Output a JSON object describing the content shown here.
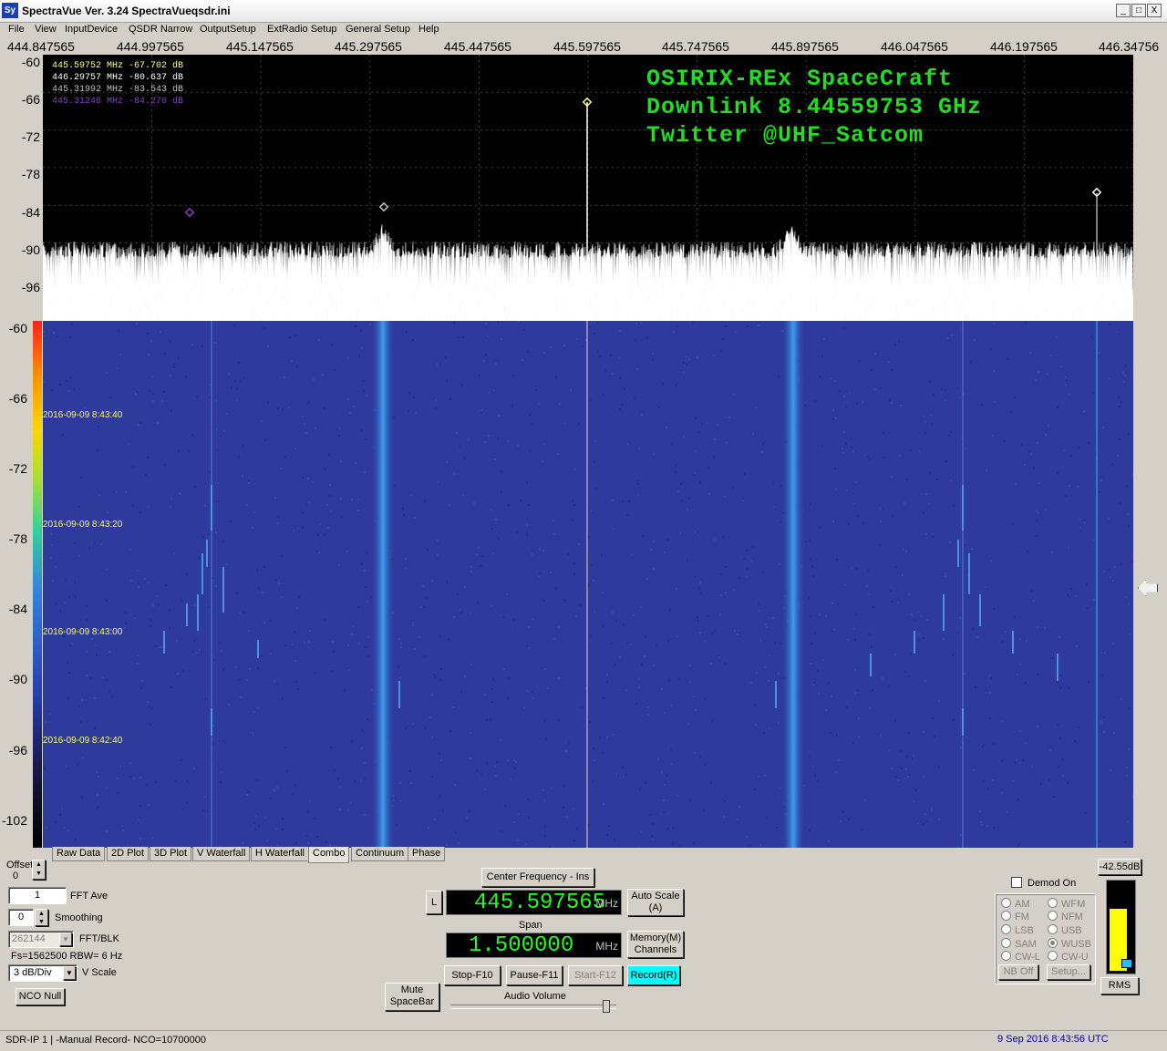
{
  "window": {
    "icon": "Sy",
    "title": "SpectraVue Ver. 3.24  SpectraVueqsdr.ini",
    "min_label": "_",
    "max_label": "□",
    "close_label": "X"
  },
  "menu": [
    "File",
    "View",
    "InputDevice",
    "QSDR Narrow",
    "OutputSetup",
    "ExtRadio Setup",
    "General Setup",
    "Help"
  ],
  "freq_axis": [
    "444.847565",
    "444.997565",
    "445.147565",
    "445.297565",
    "445.447565",
    "445.597565",
    "445.747565",
    "445.897565",
    "446.047565",
    "446.197565",
    "446.34756"
  ],
  "spectrum": {
    "y_labels": [
      "-60",
      "-66",
      "-72",
      "-78",
      "-84",
      "-90",
      "-96"
    ],
    "markers": [
      {
        "text": "445.59752 MHz -67.702 dB",
        "color": "#ffff80"
      },
      {
        "text": "446.29757 MHz -80.637 dB",
        "color": "#ffffff"
      },
      {
        "text": "445.31992 MHz -83.543 dB",
        "color": "#c0c0c0"
      },
      {
        "text": "445.31246 MHz -84.270 dB",
        "color": "#8040c0"
      }
    ],
    "overlay": [
      "OSIRIX-REx SpaceCraft",
      "Downlink 8.44559753 GHz",
      "Twitter @UHF_Satcom"
    ]
  },
  "waterfall": {
    "y_labels": [
      "-60",
      "-66",
      "-72",
      "-78",
      "-84",
      "-90",
      "-96",
      "-102"
    ],
    "timestamps": [
      "2016-09-09 8:43:40",
      "2016-09-09 8:43:20",
      "2016-09-09 8:43:00",
      "2016-09-09 8:42:40"
    ]
  },
  "tabs": [
    "Raw Data",
    "2D Plot",
    "3D Plot",
    "V Waterfall",
    "H Waterfall",
    "Combo",
    "Continuum",
    "Phase"
  ],
  "controls": {
    "offset_label": "Offset",
    "offset_value": "0",
    "fft_ave_value": "1",
    "fft_ave_label": "FFT Ave",
    "smoothing_value": "0",
    "smoothing_label": "Smoothing",
    "fft_blk_value": "262144",
    "fft_blk_label": "FFT/BLK",
    "fs_text": "Fs=1562500 RBW=   6 Hz",
    "vscale_value": "3 dB/Div",
    "vscale_label": "V Scale",
    "nco_null": "NCO Null",
    "center_freq_button": "Center Frequency - Ins",
    "l_button": "L",
    "center_freq_value": "445.597565",
    "mhz": "MHz",
    "auto_scale": "Auto Scale",
    "auto_scale_key": "(A)",
    "span_label": "Span",
    "span_value": "1.500000",
    "memory": "Memory(M)",
    "channels": "Channels",
    "mute": "Mute",
    "spacebar": "SpaceBar",
    "stop": "Stop-F10",
    "pause": "Pause-F11",
    "start": "Start-F12",
    "record": "Record(R)",
    "audio_volume": "Audio Volume",
    "demod_on": "Demod On",
    "modes_left": [
      "AM",
      "FM",
      "LSB",
      "SAM",
      "CW-L"
    ],
    "modes_right": [
      "WFM",
      "NFM",
      "USB",
      "WUSB",
      "CW-U"
    ],
    "selected_mode": "WUSB",
    "nb_off": "NB Off",
    "setup": "Setup...",
    "level_db": "-42.55dB",
    "rms": "RMS",
    "level_fraction": 0.72
  },
  "status": {
    "left": "SDR-IP 1  | -Manual Record-   NCO=10700000",
    "right": "9 Sep 2016  8:43:56 UTC"
  }
}
